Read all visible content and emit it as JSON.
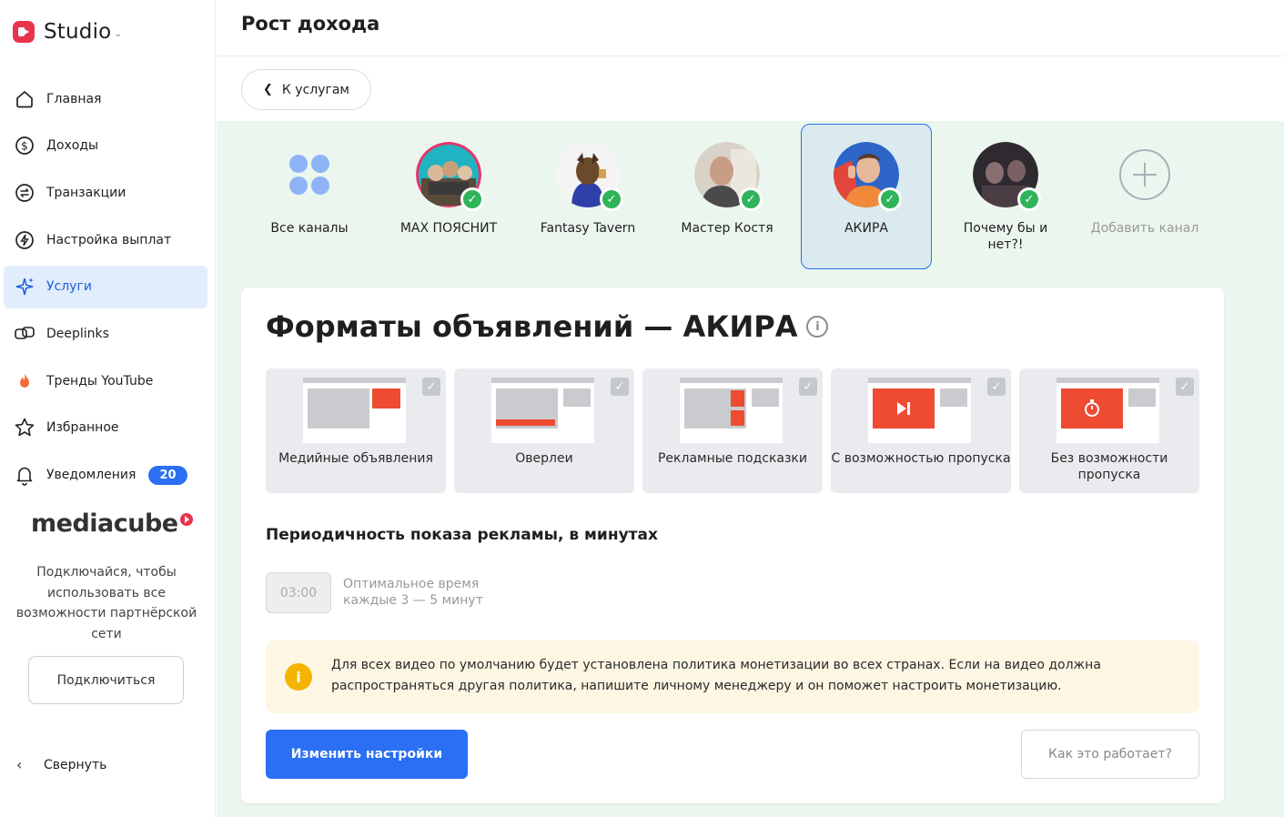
{
  "app": {
    "name": "Studio"
  },
  "sidebar": {
    "items": [
      {
        "label": "Главная",
        "icon": "home-icon"
      },
      {
        "label": "Доходы",
        "icon": "dollar-icon"
      },
      {
        "label": "Транзакции",
        "icon": "transactions-icon"
      },
      {
        "label": "Настройка выплат",
        "icon": "payout-icon"
      },
      {
        "label": "Услуги",
        "icon": "sparkle-icon",
        "active": true
      },
      {
        "label": "Deeplinks",
        "icon": "deeplinks-icon"
      },
      {
        "label": "Тренды YouTube",
        "icon": "fire-icon"
      },
      {
        "label": "Избранное",
        "icon": "star-icon"
      },
      {
        "label": "Уведомления",
        "icon": "bell-icon",
        "badge": "20"
      }
    ],
    "brand": "mediacube",
    "connect_text": "Подключайся, чтобы использовать все возможности партнёрской сети",
    "connect_button": "Подключиться",
    "collapse_label": "Свернуть"
  },
  "header": {
    "title": "Рост дохода"
  },
  "back_button": "К услугам",
  "channels": [
    {
      "name": "Все каналы"
    },
    {
      "name": "MAX ПОЯСНИТ",
      "verified": true
    },
    {
      "name": "Fantasy Tavern",
      "verified": true
    },
    {
      "name": "Мастер Костя",
      "verified": true
    },
    {
      "name": "АКИРА",
      "verified": true,
      "active": true
    },
    {
      "name": "Почему бы и нет?!",
      "verified": true
    },
    {
      "name": "Добавить канал"
    }
  ],
  "card": {
    "title": "Форматы объявлений — АКИРА",
    "formats": [
      {
        "label": "Медийные объявления",
        "checked": true
      },
      {
        "label": "Оверлеи",
        "checked": true
      },
      {
        "label": "Рекламные подсказки",
        "checked": true
      },
      {
        "label": "С возможностью пропуска",
        "checked": true
      },
      {
        "label": "Без возможности пропуска",
        "checked": true
      }
    ],
    "period_title": "Периодичность показа рекламы, в минутах",
    "period_value": "03:00",
    "period_hint_1": "Оптимальное время",
    "period_hint_2": "каждые 3 — 5 минут",
    "notice": "Для всех видео по умолчанию будет установлена политика монетизации во всех странах. Если на видео должна распространяться другая политика, напишите личному менеджеру и он поможет настроить монетизацию.",
    "primary_button": "Изменить настройки",
    "secondary_button": "Как это работает?"
  },
  "colors": {
    "accent": "#2a6ff4",
    "brand": "#e8344e",
    "success": "#2fb45a",
    "ad_red": "#ee4b33"
  }
}
